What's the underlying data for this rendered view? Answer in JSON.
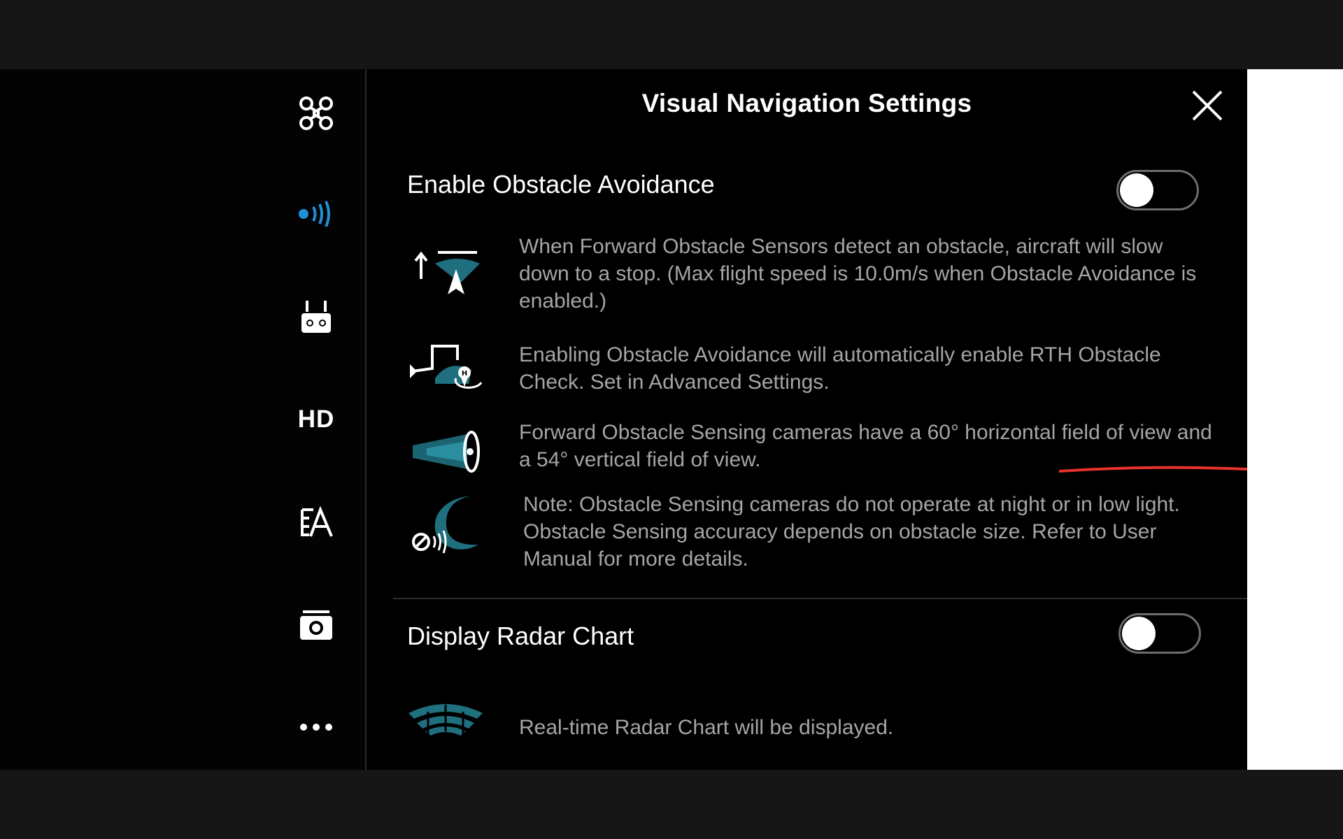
{
  "window": {
    "title": "Visual Navigation Settings",
    "close_label": "close"
  },
  "nav": {
    "items": [
      {
        "name": "aircraft",
        "icon": "drone-icon"
      },
      {
        "name": "vision-sensors",
        "icon": "obstacle-sensing-icon",
        "active": true
      },
      {
        "name": "remote-controller",
        "icon": "remote-controller-icon"
      },
      {
        "name": "hd",
        "label": "HD",
        "icon": "hd-transmission-icon"
      },
      {
        "name": "battery",
        "icon": "battery-icon"
      },
      {
        "name": "camera",
        "icon": "camera-icon"
      },
      {
        "name": "more",
        "icon": "more-icon"
      }
    ]
  },
  "settings": {
    "obstacle_avoidance": {
      "label": "Enable Obstacle Avoidance",
      "enabled": false,
      "info": [
        {
          "icon": "forward-obstacle-icon",
          "text": "When Forward Obstacle Sensors detect an obstacle, aircraft will slow down to a stop. (Max flight speed is 10.0m/s when Obstacle Avoidance is enabled.)"
        },
        {
          "icon": "rth-obstacle-check-icon",
          "text": "Enabling Obstacle Avoidance will automatically enable RTH Obstacle Check. Set in Advanced Settings."
        },
        {
          "icon": "sensing-camera-fov-icon",
          "text": "Forward Obstacle Sensing cameras have a 60° horizontal field of view and a 54° vertical field of view."
        },
        {
          "icon": "night-sensing-icon",
          "text": "Note: Obstacle Sensing cameras do not operate at night or in low light. Obstacle Sensing accuracy depends on obstacle size. Refer to User Manual for more details."
        }
      ]
    },
    "radar_chart": {
      "label": "Display Radar Chart",
      "enabled": false,
      "info": [
        {
          "icon": "radar-chart-icon",
          "text": "Real-time Radar Chart will be displayed."
        }
      ]
    }
  },
  "colors": {
    "accent": "#1f8fd6",
    "icon_teal": "#1f6f7e",
    "annotation": "#e5332a"
  }
}
